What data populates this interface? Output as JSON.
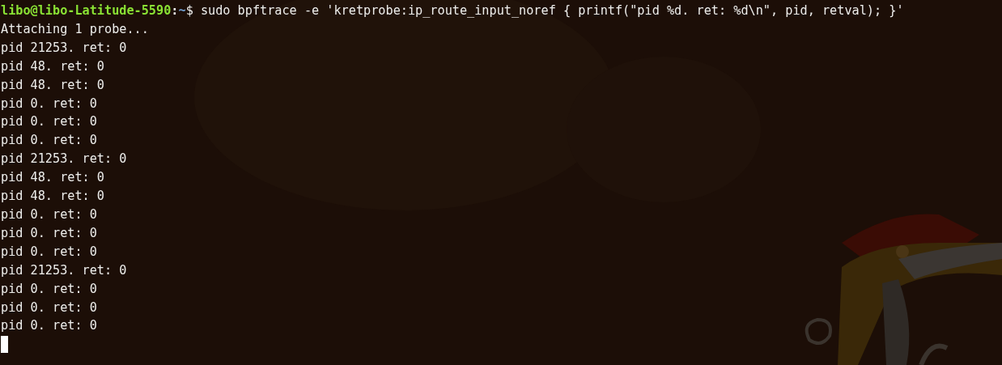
{
  "prompt": {
    "user_host": "libo@libo-Latitude-5590",
    "separator": ":",
    "path": "~",
    "symbol": "$",
    "command": "sudo bpftrace -e 'kretprobe:ip_route_input_noref { printf(\"pid %d. ret: %d\\n\", pid, retval); }'"
  },
  "output": [
    "Attaching 1 probe...",
    "pid 21253. ret: 0",
    "pid 48. ret: 0",
    "pid 48. ret: 0",
    "pid 0. ret: 0",
    "pid 0. ret: 0",
    "pid 0. ret: 0",
    "pid 21253. ret: 0",
    "pid 48. ret: 0",
    "pid 48. ret: 0",
    "pid 0. ret: 0",
    "pid 0. ret: 0",
    "pid 0. ret: 0",
    "pid 21253. ret: 0",
    "pid 0. ret: 0",
    "pid 0. ret: 0",
    "pid 0. ret: 0"
  ],
  "cursor_visible": true
}
